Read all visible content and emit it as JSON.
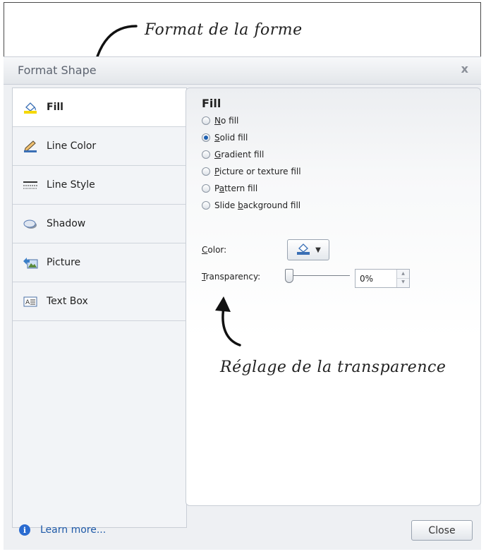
{
  "annotations": {
    "top": "Format de la forme",
    "bottom": "Réglage de la transparence"
  },
  "dialog": {
    "title": "Format Shape",
    "close_glyph": "x"
  },
  "sidebar": {
    "items": [
      {
        "label": "Fill",
        "icon": "paint-bucket-icon",
        "active": true
      },
      {
        "label": "Line Color",
        "icon": "pencil-icon",
        "active": false
      },
      {
        "label": "Line Style",
        "icon": "line-style-icon",
        "active": false
      },
      {
        "label": "Shadow",
        "icon": "shadow-icon",
        "active": false
      },
      {
        "label": "Picture",
        "icon": "picture-icon",
        "active": false
      },
      {
        "label": "Text Box",
        "icon": "text-box-icon",
        "active": false
      }
    ]
  },
  "fill_panel": {
    "title": "Fill",
    "options": [
      {
        "label": "No fill",
        "access_key": "N",
        "selected": false
      },
      {
        "label": "Solid fill",
        "access_key": "S",
        "selected": true
      },
      {
        "label": "Gradient fill",
        "access_key": "G",
        "selected": false
      },
      {
        "label": "Picture or texture fill",
        "access_key": "P",
        "selected": false
      },
      {
        "label": "Pattern fill",
        "access_key": "a",
        "selected": false
      },
      {
        "label": "Slide background fill",
        "access_key": "b",
        "selected": false
      }
    ],
    "color_label": "Color:",
    "transparency_label": "Transparency:",
    "transparency_value": "0%",
    "transparency_fraction": 0
  },
  "footer": {
    "learn_more": "Learn more...",
    "close_label": "Close"
  },
  "colors": {
    "accent": "#1c5fb0",
    "link": "#1f5aa8",
    "panel_border": "#c9ced6"
  }
}
